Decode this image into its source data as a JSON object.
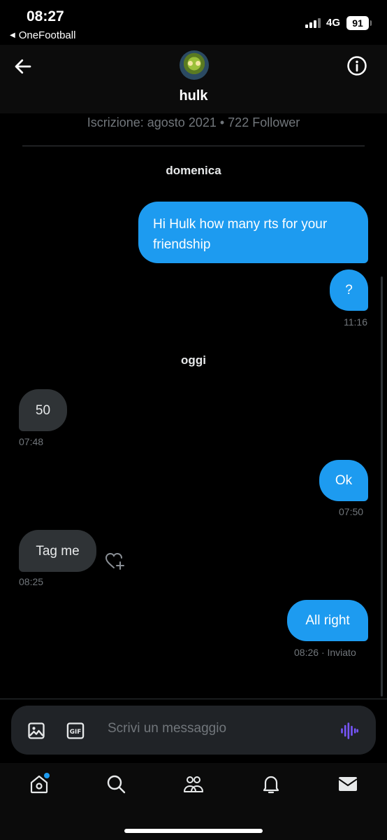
{
  "status_bar": {
    "time": "08:27",
    "back_app": "OneFootball",
    "network": "4G",
    "battery": "91"
  },
  "header": {
    "username": "hulk",
    "subtitle": "Iscrizione: agosto 2021 • 722 Follower"
  },
  "days": {
    "first": "domenica",
    "second": "oggi"
  },
  "messages": [
    {
      "text_line1": "Hi Hulk how many rts for your",
      "text_line2": "friendship",
      "side": "sent"
    },
    {
      "text": "?",
      "side": "sent",
      "time": "11:16"
    },
    {
      "text": "50",
      "side": "received",
      "time": "07:48"
    },
    {
      "text": "Ok",
      "side": "sent",
      "time": "07:50"
    },
    {
      "text": "Tag me",
      "side": "received",
      "time": "08:25"
    },
    {
      "text": "All right",
      "side": "sent",
      "time": "08:26",
      "status": "· Inviato"
    }
  ],
  "composer": {
    "placeholder": "Scrivi un messaggio"
  },
  "icons": {
    "back": "arrow-left-icon",
    "info": "info-icon",
    "react": "heart-plus-icon",
    "media": "image-icon",
    "gif": "gif-icon",
    "voice": "voice-wave-icon",
    "tabs": [
      "home-icon",
      "search-icon",
      "communities-icon",
      "notifications-icon",
      "messages-icon"
    ]
  },
  "colors": {
    "accent": "#1d9bf0",
    "received_bubble": "#2f3336",
    "voice": "#7856ff"
  }
}
